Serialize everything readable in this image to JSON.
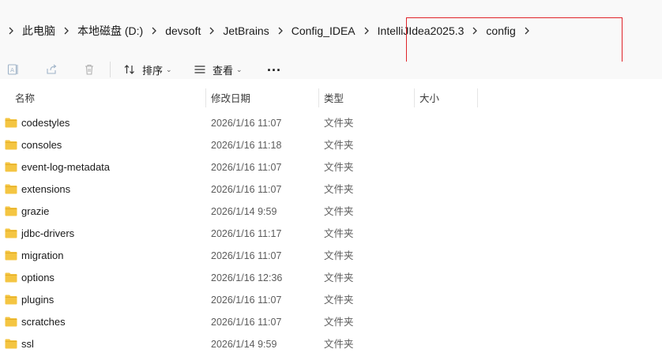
{
  "breadcrumb": [
    {
      "label": "此电脑"
    },
    {
      "label": "本地磁盘 (D:)"
    },
    {
      "label": "devsoft"
    },
    {
      "label": "JetBrains"
    },
    {
      "label": "Config_IDEA"
    },
    {
      "label": "IntelliJIdea2025.3"
    },
    {
      "label": "config"
    }
  ],
  "toolbar": {
    "sort_label": "排序",
    "view_label": "查看",
    "more_label": "..."
  },
  "columns": {
    "name": "名称",
    "modified": "修改日期",
    "type": "类型",
    "size": "大小"
  },
  "files": [
    {
      "name": "codestyles",
      "modified": "2026/1/16 11:07",
      "type": "文件夹"
    },
    {
      "name": "consoles",
      "modified": "2026/1/16 11:18",
      "type": "文件夹"
    },
    {
      "name": "event-log-metadata",
      "modified": "2026/1/16 11:07",
      "type": "文件夹"
    },
    {
      "name": "extensions",
      "modified": "2026/1/16 11:07",
      "type": "文件夹"
    },
    {
      "name": "grazie",
      "modified": "2026/1/14 9:59",
      "type": "文件夹"
    },
    {
      "name": "jdbc-drivers",
      "modified": "2026/1/16 11:17",
      "type": "文件夹"
    },
    {
      "name": "migration",
      "modified": "2026/1/16 11:07",
      "type": "文件夹"
    },
    {
      "name": "options",
      "modified": "2026/1/16 12:36",
      "type": "文件夹"
    },
    {
      "name": "plugins",
      "modified": "2026/1/16 11:07",
      "type": "文件夹"
    },
    {
      "name": "scratches",
      "modified": "2026/1/16 11:07",
      "type": "文件夹"
    },
    {
      "name": "ssl",
      "modified": "2026/1/14 9:59",
      "type": "文件夹"
    }
  ],
  "colors": {
    "folder": "#f4c542",
    "highlight": "#e0242a"
  }
}
